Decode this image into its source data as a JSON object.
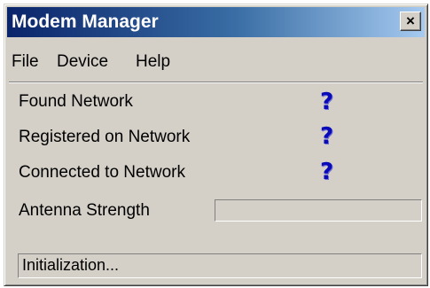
{
  "window": {
    "title": "Modem Manager",
    "close_label": "×"
  },
  "menu": {
    "items": [
      {
        "label": "File"
      },
      {
        "label": "Device"
      },
      {
        "label": "Help"
      }
    ]
  },
  "status": {
    "rows": [
      {
        "label": "Found Network",
        "icon": "question-icon",
        "glyph": "?"
      },
      {
        "label": "Registered on Network",
        "icon": "question-icon",
        "glyph": "?"
      },
      {
        "label": "Connected to Network",
        "icon": "question-icon",
        "glyph": "?"
      }
    ],
    "antenna": {
      "label": "Antenna Strength",
      "level": 0
    }
  },
  "statusbar": {
    "text": "Initialization..."
  },
  "colors": {
    "title_gradient_start": "#0a246a",
    "title_gradient_end": "#a6caf0",
    "face": "#d4d0c8",
    "question_icon": "#0a0ab8"
  }
}
